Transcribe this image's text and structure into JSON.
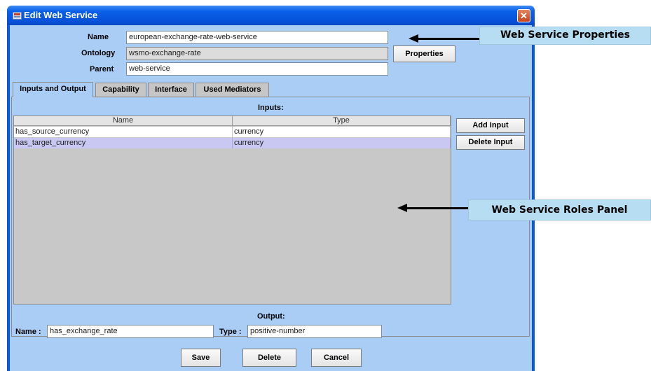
{
  "window": {
    "title": "Edit Web Service",
    "close_glyph": "✕"
  },
  "properties": {
    "name_label": "Name",
    "name_value": "european-exchange-rate-web-service",
    "ontology_label": "Ontology",
    "ontology_value": "wsmo-exchange-rate",
    "parent_label": "Parent",
    "parent_value": "web-service",
    "properties_button": "Properties"
  },
  "tabs": [
    {
      "label": "Inputs and Output",
      "active": true
    },
    {
      "label": "Capability"
    },
    {
      "label": "Interface"
    },
    {
      "label": "Used Mediators"
    }
  ],
  "inputs": {
    "title": "Inputs:",
    "columns": [
      "Name",
      "Type"
    ],
    "rows": [
      {
        "name": "has_source_currency",
        "type": "currency",
        "selected": false
      },
      {
        "name": "has_target_currency",
        "type": "currency",
        "selected": true
      }
    ],
    "add_button": "Add Input",
    "delete_button": "Delete Input"
  },
  "output": {
    "title": "Output:",
    "name_label": "Name :",
    "name_value": "has_exchange_rate",
    "type_label": "Type :",
    "type_value": "positive-number"
  },
  "buttons": {
    "save": "Save",
    "delete": "Delete",
    "cancel": "Cancel"
  },
  "annotations": {
    "properties_callout": "Web Service Properties",
    "roles_callout": "Web Service Roles Panel"
  },
  "colors": {
    "titlebar": "#0a5fe8",
    "client_bg": "#a9cdf5",
    "selected_row": "#c9c8f2",
    "callout_bg": "#b6ddf2"
  },
  "icons": [
    "app-window-icon",
    "close-icon",
    "arrow-left-icon"
  ]
}
